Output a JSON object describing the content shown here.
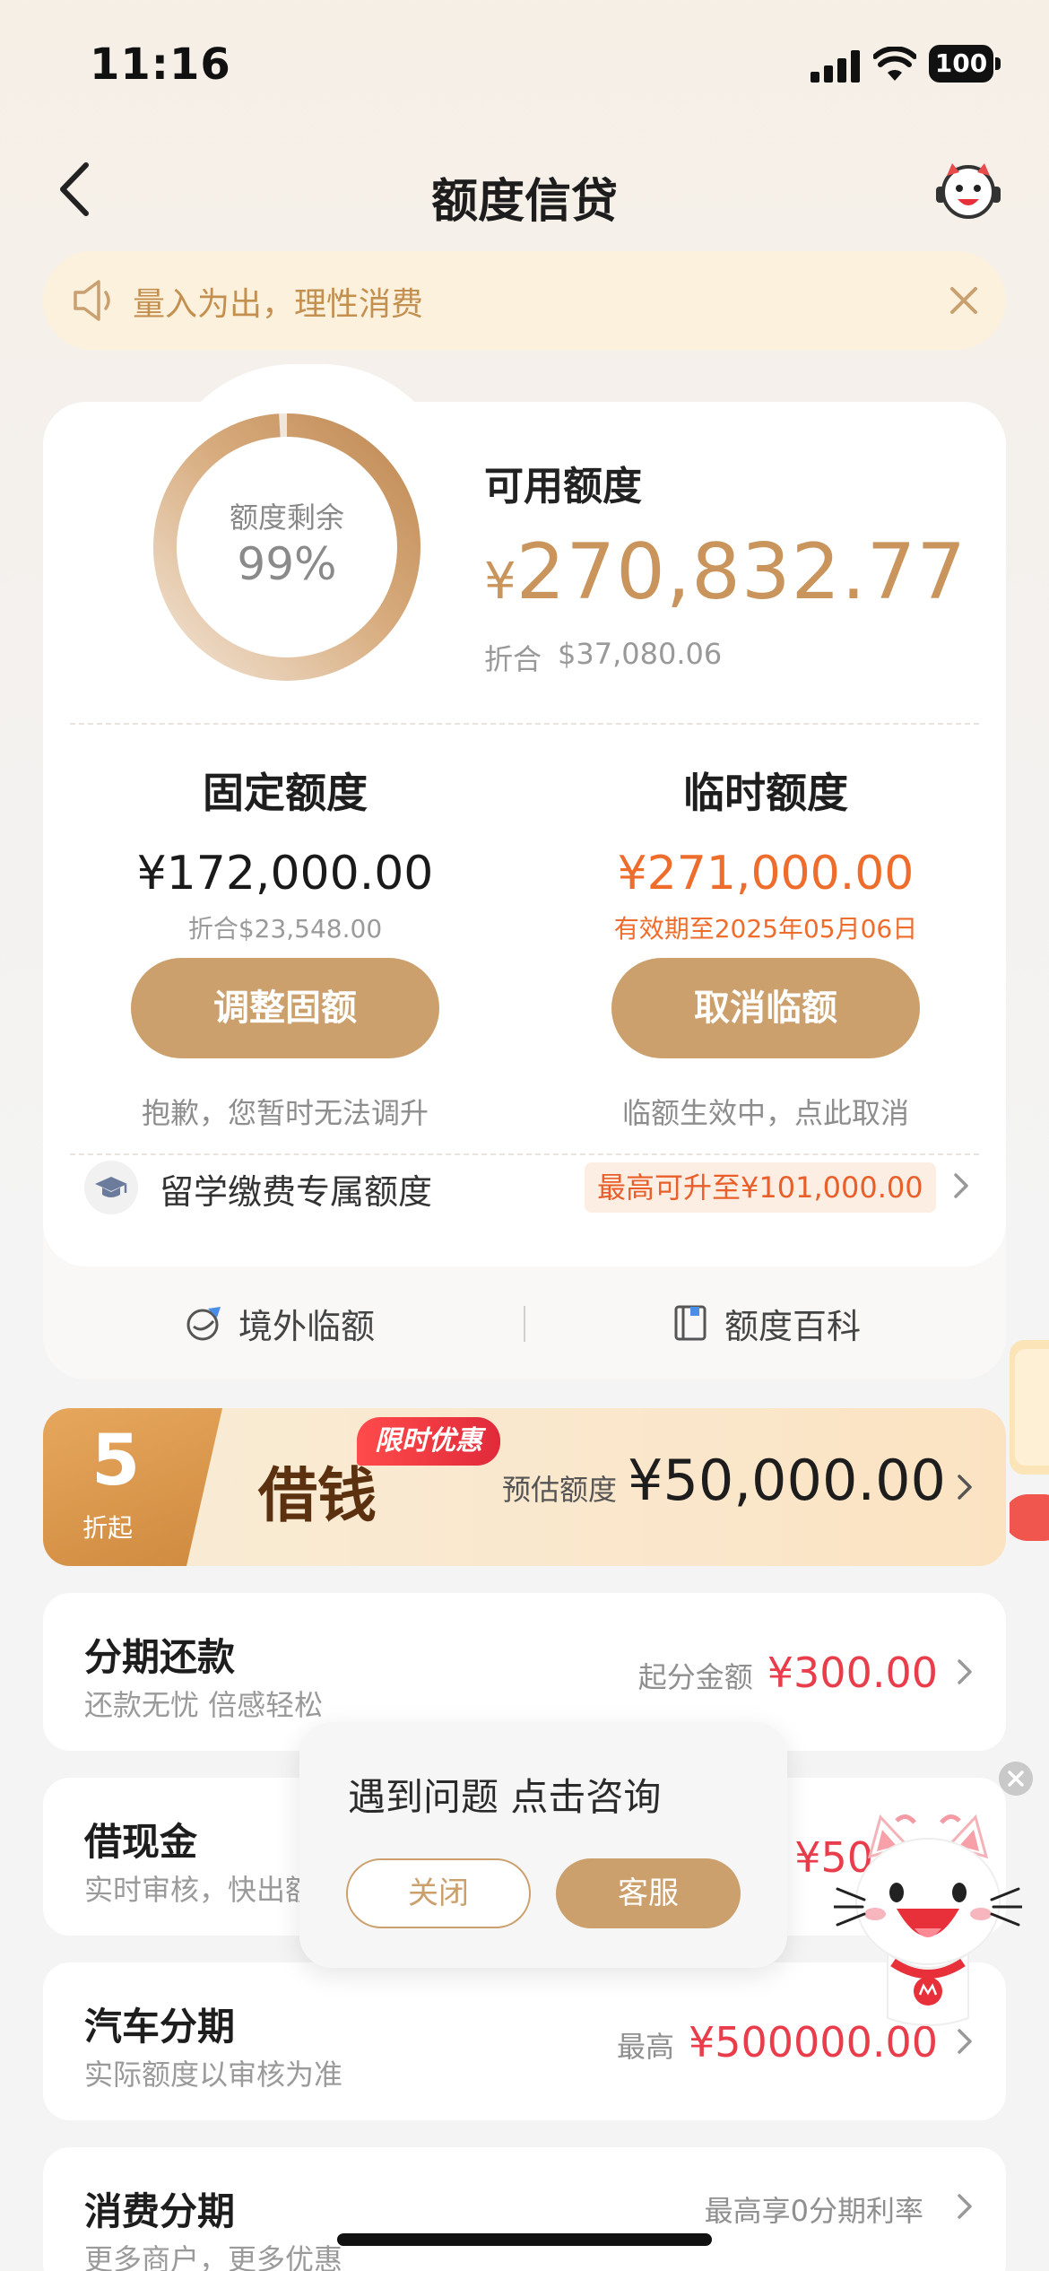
{
  "status_bar": {
    "time": "11:16",
    "battery": "100"
  },
  "nav": {
    "title": "额度信贷"
  },
  "notice": {
    "text": "量入为出，理性消费"
  },
  "credit": {
    "ring_label": "额度剩余",
    "ring_percent": "99%",
    "remaining_fraction": 0.99,
    "available_title": "可用额度",
    "currency_symbol": "¥",
    "available_amount": "270,832.77",
    "usd_label": "折合",
    "usd_value": "$37,080.06",
    "fixed": {
      "title": "固定额度",
      "amount": "¥172,000.00",
      "sub": "折合$23,548.00",
      "button": "调整固额",
      "hint": "抱歉，您暂时无法调升"
    },
    "temp": {
      "title": "临时额度",
      "amount": "¥271,000.00",
      "sub": "有效期至2025年05月06日",
      "button": "取消临额",
      "hint": "临额生效中，点此取消"
    },
    "study": {
      "label": "留学缴费专属额度",
      "badge": "最高可升至¥101,000.00"
    },
    "tools": [
      {
        "label": "境外临额",
        "icon": "globe-plane-icon"
      },
      {
        "label": "额度百科",
        "icon": "book-icon"
      }
    ]
  },
  "loan_banner": {
    "badge_number": "5",
    "badge_sub": "折起",
    "title": "借钱",
    "tag": "限时优惠",
    "estimate_label": "预估额度",
    "estimate_value": "¥50,000.00"
  },
  "products": [
    {
      "title": "分期还款",
      "sub": "还款无忧 倍感轻松",
      "right_label": "起分金额",
      "right_value": "¥300.00"
    },
    {
      "title": "借现金",
      "sub": "实时审核，快出额",
      "right_label": "",
      "right_value": "¥50"
    },
    {
      "title": "汽车分期",
      "sub": "实际额度以审核为准",
      "right_label": "最高",
      "right_value": "¥500000.00"
    },
    {
      "title": "消费分期",
      "sub": "更多商户，更多优惠",
      "right_label": "最高享0分期利率",
      "right_value": ""
    }
  ],
  "popup": {
    "text": "遇到问题 点击咨询",
    "close_label": "关闭",
    "service_label": "客服"
  },
  "colors": {
    "gold": "#cca06d",
    "amount_gold": "#c9955c",
    "orange": "#ee6d2c",
    "red": "#ea3d4b",
    "notice_bg": "#fcf1dd"
  }
}
